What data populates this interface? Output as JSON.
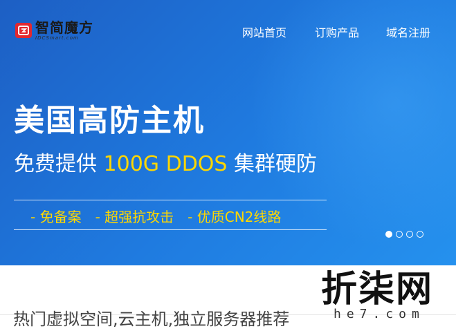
{
  "brand": {
    "name_cn": "智简魔方",
    "name_en": "IDCSmart.com",
    "color": "#e3282f"
  },
  "nav": {
    "items": [
      {
        "label": "网站首页"
      },
      {
        "label": "订购产品"
      },
      {
        "label": "域名注册"
      }
    ]
  },
  "banner": {
    "headline": "美国高防主机",
    "sub_prefix": "免费提供 ",
    "sub_highlight": "100G DDOS",
    "sub_suffix": " 集群硬防",
    "features": [
      "- 免备案",
      "- 超强抗攻击",
      "- 优质CN2线路"
    ],
    "slides": [
      {
        "active": true
      },
      {
        "active": false
      },
      {
        "active": false
      },
      {
        "active": false
      }
    ],
    "background_color": "#1f7be0",
    "highlight_color": "#ffd700"
  },
  "section": {
    "title": "热门虚拟空间,云主机,独立服务器推荐"
  },
  "watermark": {
    "text_cn": "折柒网",
    "text_en": "he7.com"
  }
}
